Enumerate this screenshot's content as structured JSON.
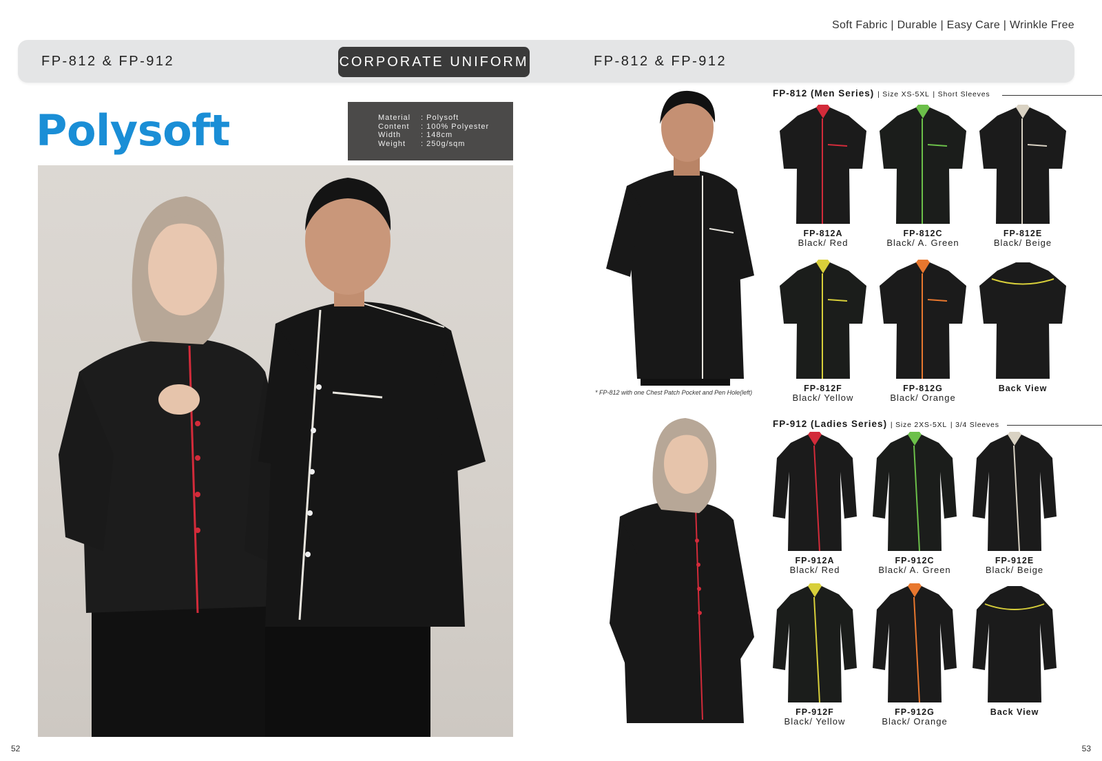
{
  "header": {
    "features": "Soft Fabric | Durable | Easy Care | Wrinkle Free",
    "code_left": "FP-812 & FP-912",
    "category": "CORPORATE UNIFORM",
    "code_right": "FP-812 & FP-912"
  },
  "brand": {
    "logo": "Polysoft"
  },
  "spec": {
    "rows": [
      {
        "k": "Material",
        "v": ": Polysoft"
      },
      {
        "k": "Content",
        "v": ": 100% Polyester"
      },
      {
        "k": "Width",
        "v": ": 148cm"
      },
      {
        "k": "Weight",
        "v": ": 250g/sqm"
      }
    ]
  },
  "men": {
    "title": "FP-812 (Men Series)",
    "size": "| Size XS-5XL",
    "sleeve": "| Short Sleeves",
    "note": "* FP-812 with one Chest Patch Pocket and Pen Hole(left)",
    "products": [
      {
        "code": "FP-812A",
        "color": "Black/ Red",
        "accent": "#d32b3a"
      },
      {
        "code": "FP-812C",
        "color": "Black/ A. Green",
        "accent": "#6cc04a"
      },
      {
        "code": "FP-812E",
        "color": "Black/ Beige",
        "accent": "#d9d2c3"
      },
      {
        "code": "FP-812F",
        "color": "Black/ Yellow",
        "accent": "#d8cf3a"
      },
      {
        "code": "FP-812G",
        "color": "Black/ Orange",
        "accent": "#e8772e"
      },
      {
        "code": "Back View",
        "color": "",
        "accent": "#d8cf3a"
      }
    ]
  },
  "ladies": {
    "title": "FP-912 (Ladies Series)",
    "size": "| Size 2XS-5XL",
    "sleeve": "| 3/4 Sleeves",
    "products": [
      {
        "code": "FP-912A",
        "color": "Black/ Red",
        "accent": "#d32b3a"
      },
      {
        "code": "FP-912C",
        "color": "Black/ A. Green",
        "accent": "#6cc04a"
      },
      {
        "code": "FP-912E",
        "color": "Black/ Beige",
        "accent": "#d9d2c3"
      },
      {
        "code": "FP-912F",
        "color": "Black/ Yellow",
        "accent": "#d8cf3a"
      },
      {
        "code": "FP-912G",
        "color": "Black/ Orange",
        "accent": "#e8772e"
      },
      {
        "code": "Back View",
        "color": "",
        "accent": "#d8cf3a"
      }
    ]
  },
  "pages": {
    "left": "52",
    "right": "53"
  }
}
